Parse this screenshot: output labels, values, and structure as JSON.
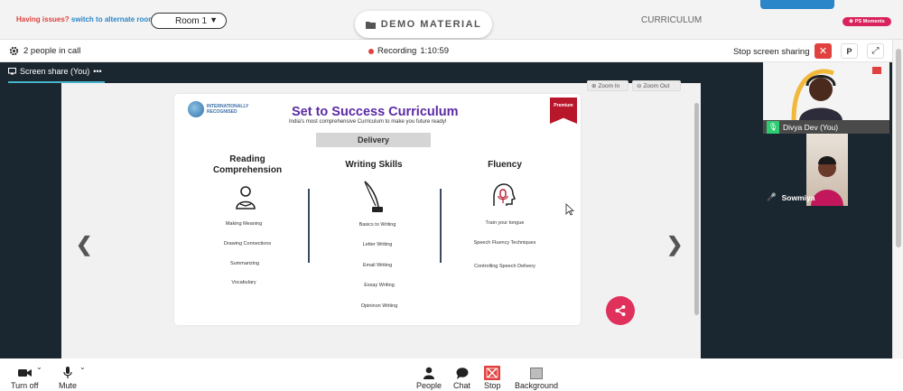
{
  "topbar": {
    "issues_text": "Having issues?",
    "switch_text": "switch to alternate room",
    "room_label": "Room 1",
    "demo_label": "DEMO MATERIAL",
    "curriculum_label": "CURRICULUM",
    "ps_moments_label": "PS Moments"
  },
  "callbar": {
    "people_count": "2 people in call",
    "recording_label": "Recording",
    "recording_time": "1:10:59",
    "stop_share_label": "Stop screen sharing",
    "p_label": "P"
  },
  "stage": {
    "share_tab_label": "Screen share (You)",
    "zoom_in_label": "Zoom In",
    "zoom_out_label": "Zoom Out"
  },
  "slide": {
    "title": "Set to Success Curriculum",
    "subtitle": "India's most comprehensive Curriculum to make you future ready!",
    "intl_line1": "INTERNATIONALLY",
    "intl_line2": "RECOGNISED",
    "premium_label": "Premium",
    "delivery_label": "Delivery",
    "columns": [
      {
        "heading": "Reading Comprehension",
        "items": [
          "Making Meaning",
          "Drawing Connections",
          "Summarizing",
          "Vocabulary"
        ]
      },
      {
        "heading": "Writing Skills",
        "items": [
          "Basics to Writing",
          "Letter Writing",
          "Email Writing",
          "Essay Writing",
          "Opininon Writing"
        ]
      },
      {
        "heading": "Fluency",
        "items": [
          "Train your tongue",
          "Speech Fluency Techniques",
          "Controlling Speech Delivery"
        ]
      }
    ]
  },
  "participants": [
    {
      "name": "Divya Dev (You)"
    },
    {
      "name": "Sowmiya"
    }
  ],
  "controls": {
    "turn_off": "Turn off",
    "mute": "Mute",
    "people": "People",
    "chat": "Chat",
    "stop": "Stop",
    "background": "Background"
  },
  "colors": {
    "accent_red": "#e0413f",
    "brand_blue": "#2a86c8",
    "title_purple": "#5b2aa5",
    "stage_bg": "#1b2730",
    "share_pink": "#e0305c"
  }
}
